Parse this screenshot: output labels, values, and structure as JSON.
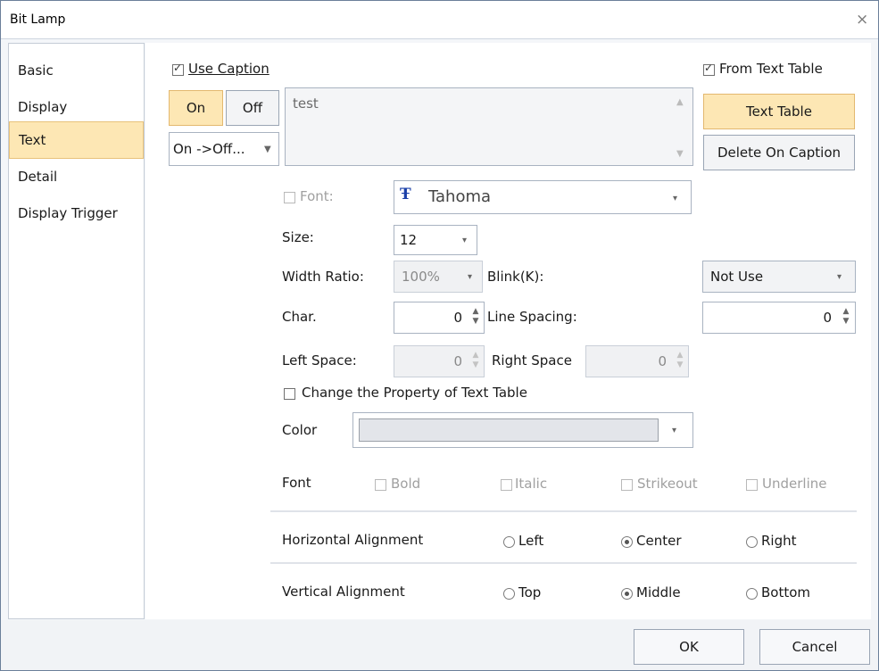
{
  "window": {
    "title": "Bit Lamp",
    "close_glyph": "×"
  },
  "sidebar": {
    "items": [
      "Basic",
      "Display",
      "Text",
      "Detail",
      "Display Trigger"
    ],
    "active": "Text"
  },
  "caption": {
    "use_caption": "Use Caption",
    "on": "On",
    "off": "Off",
    "direction": "On ->Off...",
    "text": "test",
    "from_text_table": "From Text Table",
    "text_table_button": "Text Table",
    "delete_on_caption": "Delete On Caption"
  },
  "font": {
    "font_label": "Font:",
    "font_icon_glyph": "Ŧ",
    "font_value": "Tahoma",
    "size_label": "Size:",
    "size_value": "12",
    "width_ratio_label": "Width Ratio:",
    "width_ratio_value": "100%",
    "blink_label": "Blink(K):",
    "blink_value": "Not Use",
    "char_label": "Char.",
    "char_value": "0",
    "line_spacing_label": "Line Spacing:",
    "line_spacing_value": "0",
    "left_space_label": "Left Space:",
    "left_space_value": "0",
    "right_space_label": "Right Space",
    "right_space_value": "0",
    "change_property": "Change the Property of Text Table",
    "color_label": "Color",
    "font_style_label": "Font",
    "bold": "Bold",
    "italic": "Italic",
    "strikeout": "Strikeout",
    "underline": "Underline"
  },
  "alignment": {
    "horizontal_label": "Horizontal Alignment",
    "h_left": "Left",
    "h_center": "Center",
    "h_right": "Right",
    "h_selected": "Center",
    "vertical_label": "Vertical Alignment",
    "v_top": "Top",
    "v_middle": "Middle",
    "v_bottom": "Bottom",
    "v_selected": "Middle"
  },
  "footer": {
    "ok": "OK",
    "cancel": "Cancel"
  },
  "colors": {
    "accent_highlight": "#fde7b4",
    "accent_border": "#e3b86f",
    "font_icon": "#1a3fa8"
  }
}
